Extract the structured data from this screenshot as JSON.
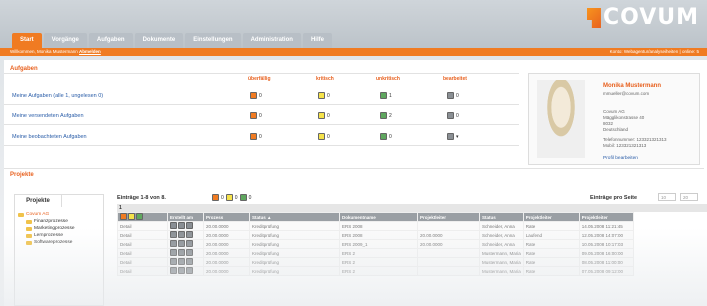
{
  "header": {
    "tabs": [
      "Start",
      "Vorgänge",
      "Aufgaben",
      "Dokumente",
      "Einstellungen",
      "Administration",
      "Hilfe"
    ],
    "active_tab": "Start",
    "logo_text": "COVUM",
    "welcome": "Willkommen, Monika Mustermann",
    "logout": "Abmelden",
    "right_status": "Konto: Webagentur/analyseiheiten | online: 5"
  },
  "aufgaben": {
    "title": "Aufgaben",
    "columns": [
      "überfällig",
      "kritisch",
      "unkritisch",
      "bearbeitet"
    ],
    "rows": [
      {
        "label": "Meine Aufgaben (alle 1, ungelesen 0)",
        "counts": [
          "0",
          "0",
          "1",
          "0"
        ]
      },
      {
        "label": "Meine versendeten Aufgaben",
        "counts": [
          "0",
          "0",
          "2",
          "0"
        ]
      },
      {
        "label": "Meine beobachteten Aufgaben",
        "counts": [
          "0",
          "0",
          "0",
          "▾"
        ]
      }
    ]
  },
  "profile": {
    "name": "Monika Mustermann",
    "email": "mmueller@covum.com",
    "company": "Covum AG",
    "street": "Mägglikonstrasse 40",
    "city": "8032",
    "country": "Deutschland",
    "phone": "Telefonnummer: 123321321313",
    "mobile": "Mobil: 123321321313",
    "edit": "Profil bearbeiten"
  },
  "projekte": {
    "title": "Projekte",
    "tree_tab": "Projekte",
    "tree": [
      "Covum AG",
      "Finanzprozesse",
      "Marketingprozesse",
      "Lernprozesse",
      "Softwareprozesse"
    ],
    "entries": "Einträge 1-8 von 8.",
    "legend": [
      "0",
      "0",
      "0"
    ],
    "per_page_label": "Einträge pro Seite",
    "per_page_options": [
      "10",
      "20"
    ],
    "page_num": "1",
    "table_headers": [
      "Erstellt am",
      "Prozess",
      "Status ▲",
      "Dokumentname",
      "Projektleiter",
      "Status",
      "Projektleiter",
      "Projektleiter"
    ],
    "table_rows": [
      [
        "Detail",
        "20.00.0000",
        "Kreditprüfung",
        "ERS 2008",
        "",
        "Schneider, Anna",
        "Rate",
        "14.05.2008 11:21:45"
      ],
      [
        "Detail",
        "20.00.0000",
        "Kreditprüfung",
        "ERS 2008",
        "20.00.0000",
        "Schneider, Anna",
        "Laufend",
        "12.05.2008 14:07:00"
      ],
      [
        "Detail",
        "20.00.0000",
        "Kreditprüfung",
        "ERS 2009_1",
        "20.00.0000",
        "Schneider, Anna",
        "Rate",
        "10.05.2008 10:17:03"
      ],
      [
        "Detail",
        "20.00.0000",
        "Kreditprüfung",
        "ERS 2",
        "",
        "Mustermann, Maria",
        "Rate",
        "09.05.2008 16:00:00"
      ],
      [
        "Detail",
        "20.00.0000",
        "Kreditprüfung",
        "ERS 2",
        "",
        "Mustermann, Maria",
        "Rate",
        "08.05.2008 11:00:00"
      ],
      [
        "Detail",
        "20.00.0000",
        "Kreditprüfung",
        "ERS 2",
        "",
        "Mustermann, Maria",
        "Rate",
        "07.05.2008 09:12:00"
      ]
    ]
  }
}
